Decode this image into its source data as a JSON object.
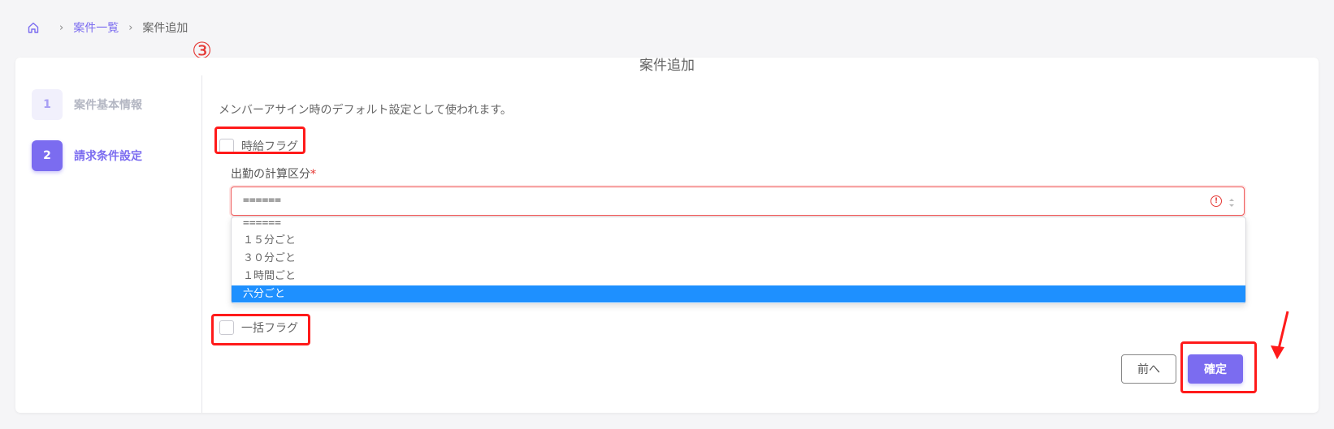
{
  "breadcrumb": {
    "home_icon": "home-icon",
    "items": [
      "案件一覧",
      "案件追加"
    ]
  },
  "step_marker": "③",
  "card": {
    "title": "案件追加"
  },
  "steps": [
    {
      "number": "1",
      "label": "案件基本情報",
      "state": "inactive"
    },
    {
      "number": "2",
      "label": "請求条件設定",
      "state": "active"
    }
  ],
  "form": {
    "description": "メンバーアサイン時のデフォルト設定として使われます。",
    "hourly_flag": {
      "label": "時給フラグ",
      "checked": false
    },
    "calc_type": {
      "label": "出勤の計算区分",
      "required_mark": "*",
      "value": "======",
      "options": [
        "======",
        "１５分ごと",
        "３０分ごと",
        "１時間ごと",
        "六分ごと"
      ],
      "highlighted_option": "六分ごと"
    },
    "bulk_flag": {
      "label": "一括フラグ",
      "checked": false
    }
  },
  "buttons": {
    "prev": "前へ",
    "confirm": "確定"
  },
  "colors": {
    "accent": "#7b6cf0",
    "highlight": "#1e90ff",
    "annotation": "#ff1a1a",
    "error": "#e53935"
  }
}
